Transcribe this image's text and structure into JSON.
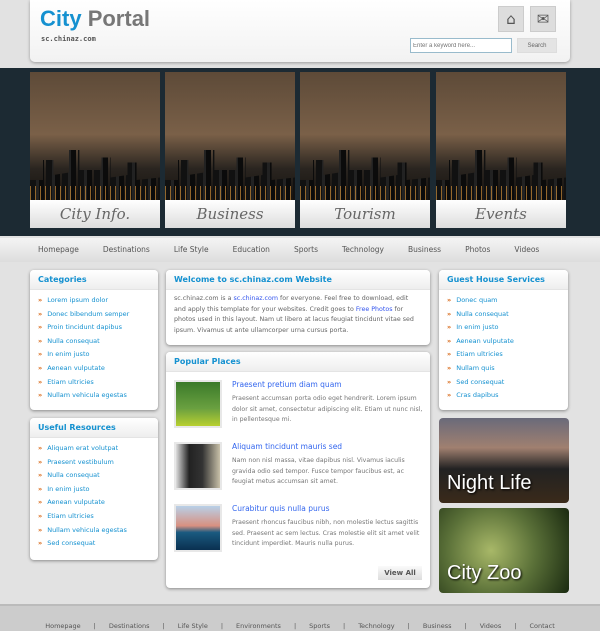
{
  "header": {
    "logo_a": "City",
    "logo_b": "Portal",
    "subtitle": "sc.chinaz.com",
    "search_placeholder": "Enter a keyword here...",
    "search_button": "Search",
    "icons": [
      "home-icon",
      "mail-icon"
    ]
  },
  "banner": [
    {
      "label": "City Info."
    },
    {
      "label": "Business"
    },
    {
      "label": "Tourism"
    },
    {
      "label": "Events"
    }
  ],
  "nav": [
    "Homepage",
    "Destinations",
    "Life Style",
    "Education",
    "Sports",
    "Technology",
    "Business",
    "Photos",
    "Videos"
  ],
  "categories": {
    "title": "Categories",
    "items": [
      "Lorem ipsum dolor",
      "Donec bibendum semper",
      "Proin tincidunt dapibus",
      "Nulla consequat",
      "In enim justo",
      "Aenean vulputate",
      "Etiam ultricies",
      "Nullam vehicula egestas"
    ]
  },
  "resources": {
    "title": "Useful Resources",
    "items": [
      "Aliquam erat volutpat",
      "Praesent vestibulum",
      "Nulla consequat",
      "In enim justo",
      "Aenean vulputate",
      "Etiam ultricies",
      "Nullam vehicula egestas",
      "Sed consequat"
    ]
  },
  "welcome": {
    "title": "Welcome to sc.chinaz.com Website",
    "t1": "sc.chinaz.com is a ",
    "link1": "sc.chinaz.com",
    "t2": " for everyone. Feel free to download, edit and apply this template for your websites. Credit goes to ",
    "link2": "Free Photos",
    "t3": " for photos used in this layout. Nam ut libero at lacus feugiat tincidunt vitae sed ipsum. Vivamus ut ante ullamcorper urna cursus porta."
  },
  "popular": {
    "title": "Popular Places",
    "view_all": "View All",
    "items": [
      {
        "title": "Praesent pretium diam quam",
        "desc": "Praesent accumsan porta odio eget hendrerit. Lorem ipsum dolor sit amet, consectetur adipiscing elit. Etiam ut nunc nisl, in pellentesque mi."
      },
      {
        "title": "Aliquam tincidunt mauris sed",
        "desc": "Nam non nisl massa, vitae dapibus nisl. Vivamus iaculis gravida odio sed tempor. Fusce tempor faucibus est, ac feugiat metus accumsan sit amet."
      },
      {
        "title": "Curabitur quis nulla purus",
        "desc": "Praesent rhoncus faucibus nibh, non molestie lectus sagittis sed. Praesent ac sem lectus. Cras molestie elit sit amet velit tincidunt imperdiet. Mauris nulla purus."
      }
    ]
  },
  "guest": {
    "title": "Guest House Services",
    "items": [
      "Donec quam",
      "Nulla consequat",
      "In enim justo",
      "Aenean vulputate",
      "Etiam ultricies",
      "Nullam quis",
      "Sed consequat",
      "Cras dapibus"
    ]
  },
  "promos": {
    "night": "Night Life",
    "zoo": "City Zoo"
  },
  "footer": [
    "Homepage",
    "Destinations",
    "Life Style",
    "Environments",
    "Sports",
    "Technology",
    "Business",
    "Videos",
    "Contact"
  ],
  "colors": {
    "accent": "#1591d0",
    "bullet": "#d86818",
    "band": "#1c2a33"
  }
}
